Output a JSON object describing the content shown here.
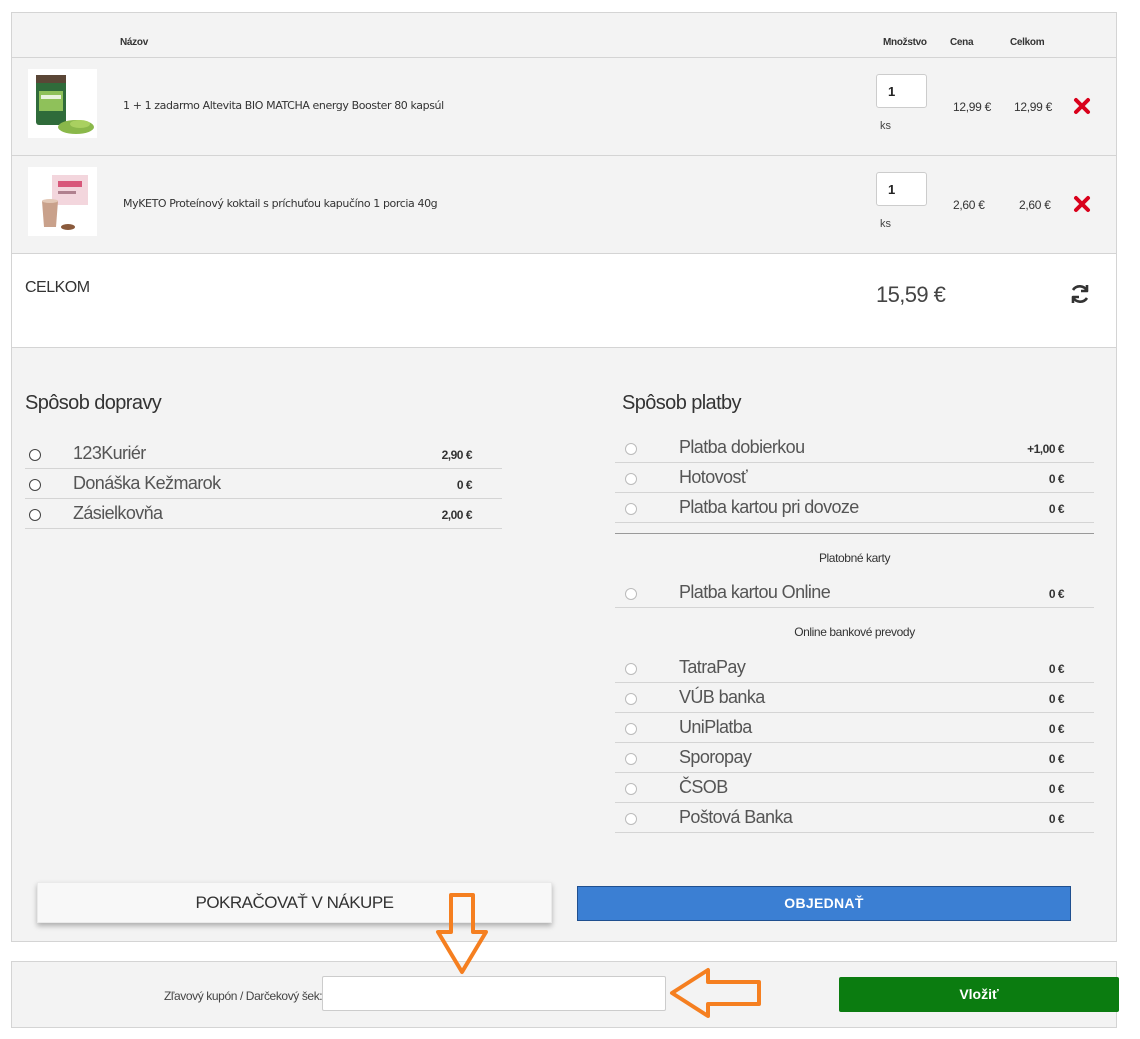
{
  "cart": {
    "columns": {
      "name": "Názov",
      "quantity": "Množstvo",
      "price": "Cena",
      "total": "Celkom"
    },
    "items": [
      {
        "name": "1 + 1 zadarmo Altevita BIO MATCHA energy Booster 80 kapsúl",
        "quantity": "1",
        "unit": "ks",
        "price": "12,99 €",
        "total": "12,99 €"
      },
      {
        "name": "MyKETO Proteínový koktail s príchuťou kapučíno 1 porcia 40g",
        "quantity": "1",
        "unit": "ks",
        "price": "2,60 €",
        "total": "2,60 €"
      }
    ],
    "total_label": "CELKOM",
    "total_value": "15,59 €"
  },
  "shipping": {
    "title": "Spôsob dopravy",
    "options": [
      {
        "label": "123Kuriér",
        "price": "2,90 €"
      },
      {
        "label": "Donáška Kežmarok",
        "price": "0 €"
      },
      {
        "label": "Zásielkovňa",
        "price": "2,00 €"
      }
    ]
  },
  "payment": {
    "title": "Spôsob platby",
    "options": [
      {
        "label": "Platba dobierkou",
        "price": "+1,00 €"
      },
      {
        "label": "Hotovosť",
        "price": "0 €"
      },
      {
        "label": "Platba kartou pri dovoze",
        "price": "0 €"
      }
    ],
    "cards_heading": "Platobné karty",
    "cards": [
      {
        "label": "Platba kartou Online",
        "price": "0 €"
      }
    ],
    "transfers_heading": "Online bankové prevody",
    "transfers": [
      {
        "label": "TatraPay",
        "price": "0 €"
      },
      {
        "label": "VÚB banka",
        "price": "0 €"
      },
      {
        "label": "UniPlatba",
        "price": "0 €"
      },
      {
        "label": "Sporopay",
        "price": "0 €"
      },
      {
        "label": "ČSOB",
        "price": "0 €"
      },
      {
        "label": "Poštová Banka",
        "price": "0 €"
      }
    ]
  },
  "actions": {
    "continue_label": "POKRAČOVAŤ V NÁKUPE",
    "order_label": "OBJEDNAŤ"
  },
  "coupon": {
    "label": "Zľavový kupón / Darčekový šek:",
    "value": "",
    "button_label": "Vložiť"
  },
  "colors": {
    "remove": "#d9001b",
    "order_button": "#3b7fd3",
    "insert_button": "#0b7c10",
    "annotation_arrow": "#f57f20"
  },
  "icons": [
    "remove-icon",
    "refresh-icon",
    "annotation-arrow-down",
    "annotation-arrow-left"
  ]
}
